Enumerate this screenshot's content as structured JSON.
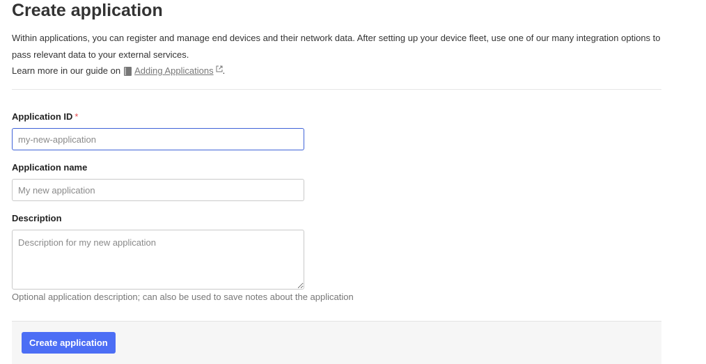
{
  "page": {
    "title": "Create application",
    "intro_text": "Within applications, you can register and manage end devices and their network data. After setting up your device fleet, use one of our many integration options to pass relevant data to your external services.",
    "guide_prefix": "Learn more in our guide on",
    "guide_link_label": "Adding Applications",
    "guide_suffix": "."
  },
  "form": {
    "app_id": {
      "label": "Application ID",
      "required_mark": "*",
      "placeholder": "my-new-application",
      "value": ""
    },
    "app_name": {
      "label": "Application name",
      "placeholder": "My new application",
      "value": ""
    },
    "description": {
      "label": "Description",
      "placeholder": "Description for my new application",
      "value": "",
      "hint": "Optional application description; can also be used to save notes about the application"
    }
  },
  "actions": {
    "submit_label": "Create application"
  },
  "icons": {
    "guide": "book-icon",
    "external": "external-link-icon"
  },
  "colors": {
    "primary": "#4c6ef5",
    "required": "#e5484d",
    "focus_border": "#3e62d8"
  }
}
